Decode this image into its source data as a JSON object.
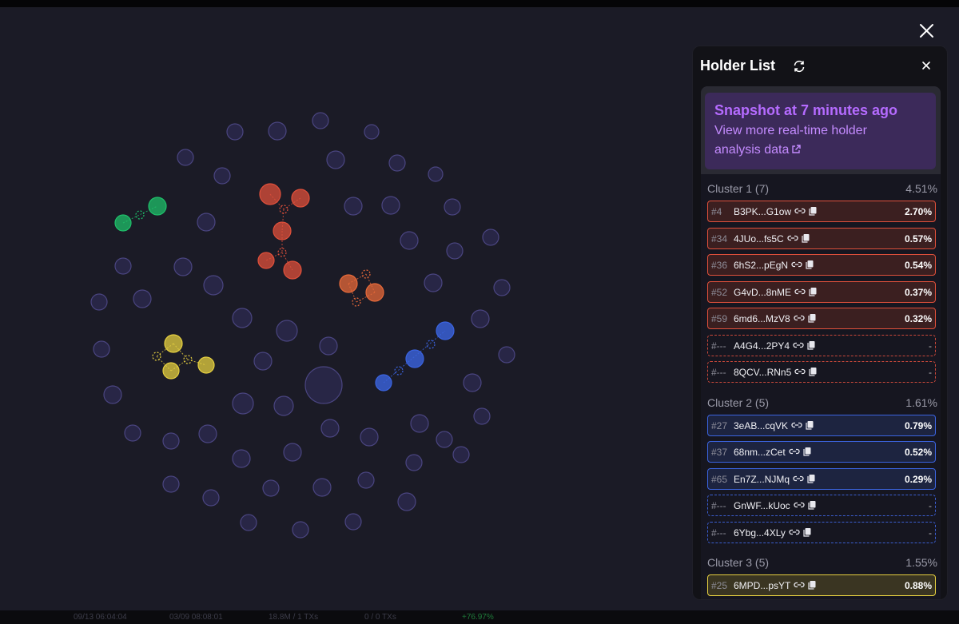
{
  "bottom_bar": {
    "items": [
      "09/13 06:04:04",
      "03/09 08:08:01",
      "18.8M / 1 TXs",
      "0 / 0 TXs",
      "+76.97%"
    ]
  },
  "colors": {
    "accent": "#b56bff",
    "cluster1": "#e0503b",
    "cluster2": "#3b64e0",
    "cluster3": "#e6d040",
    "cluster_green": "#1fc06a",
    "cluster_orange": "#e86a3a",
    "node_default": "#2e2b52"
  },
  "panel": {
    "title": "Holder List",
    "refresh_icon": "refresh-icon",
    "close_icon": "close-icon"
  },
  "snapshot": {
    "title": "Snapshot at 7 minutes ago",
    "link_line1": "View more real-time holder",
    "link_line2": "analysis data",
    "link_icon": "external-link-icon"
  },
  "clusters": [
    {
      "name": "Cluster 1 (7)",
      "percent": "4.51%",
      "color": "red",
      "holders": [
        {
          "rank": "#4",
          "address": "B3PK...G1ow",
          "percent": "2.70%",
          "dashed": false
        },
        {
          "rank": "#34",
          "address": "4JUo...fs5C",
          "percent": "0.57%",
          "dashed": false
        },
        {
          "rank": "#36",
          "address": "6hS2...pEgN",
          "percent": "0.54%",
          "dashed": false
        },
        {
          "rank": "#52",
          "address": "G4vD...8nME",
          "percent": "0.37%",
          "dashed": false
        },
        {
          "rank": "#59",
          "address": "6md6...MzV8",
          "percent": "0.32%",
          "dashed": false
        },
        {
          "rank": "#---",
          "address": "A4G4...2PY4",
          "percent": "-",
          "dashed": true
        },
        {
          "rank": "#---",
          "address": "8QCV...RNn5",
          "percent": "-",
          "dashed": true
        }
      ]
    },
    {
      "name": "Cluster 2 (5)",
      "percent": "1.61%",
      "color": "blue",
      "holders": [
        {
          "rank": "#27",
          "address": "3eAB...cqVK",
          "percent": "0.79%",
          "dashed": false
        },
        {
          "rank": "#37",
          "address": "68nm...zCet",
          "percent": "0.52%",
          "dashed": false
        },
        {
          "rank": "#65",
          "address": "En7Z...NJMq",
          "percent": "0.29%",
          "dashed": false
        },
        {
          "rank": "#---",
          "address": "GnWF...kUoc",
          "percent": "-",
          "dashed": true
        },
        {
          "rank": "#---",
          "address": "6Ybg...4XLy",
          "percent": "-",
          "dashed": true
        }
      ]
    },
    {
      "name": "Cluster 3 (5)",
      "percent": "1.55%",
      "color": "yellow",
      "holders": [
        {
          "rank": "#25",
          "address": "6MPD...psYT",
          "percent": "0.88%",
          "dashed": false
        }
      ]
    }
  ]
}
